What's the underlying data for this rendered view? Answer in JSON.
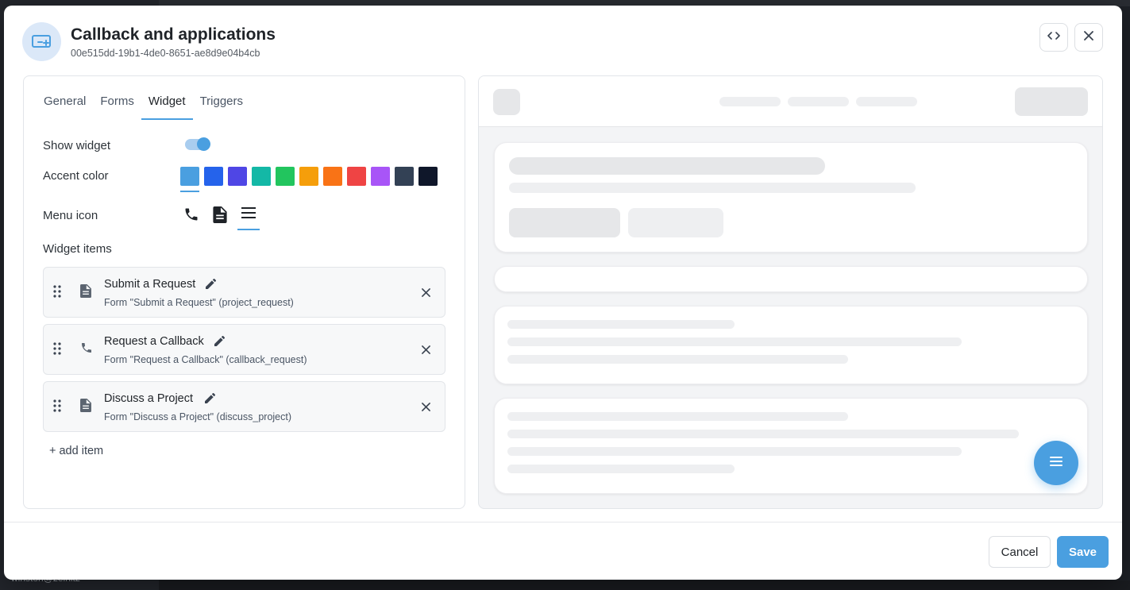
{
  "background": {
    "user_label": "winston@zeinitz"
  },
  "modal": {
    "title": "Callback and applications",
    "subtitle": "00e515dd-19b1-4de0-8651-ae8d9e04b4cb",
    "code_button_icon": "code-icon",
    "close_button_icon": "close-icon"
  },
  "tabs": [
    {
      "label": "General",
      "active": false
    },
    {
      "label": "Forms",
      "active": false
    },
    {
      "label": "Widget",
      "active": true
    },
    {
      "label": "Triggers",
      "active": false
    }
  ],
  "widget": {
    "show_widget_label": "Show widget",
    "show_widget_on": true,
    "accent_color_label": "Accent color",
    "accent_colors": [
      "#4a9fe0",
      "#2563eb",
      "#4f46e5",
      "#14b8a6",
      "#22c55e",
      "#f59e0b",
      "#f97316",
      "#ef4444",
      "#a855f7",
      "#334155",
      "#0f172a"
    ],
    "accent_selected": "#4a9fe0",
    "menu_icon_label": "Menu icon",
    "menu_icons": [
      "phone-icon",
      "document-icon",
      "menu-icon"
    ],
    "menu_icon_selected": "menu-icon",
    "items_label": "Widget items",
    "items": [
      {
        "title": "Submit a Request",
        "desc": "Form \"Submit a Request\" (project_request)",
        "icon": "document-icon"
      },
      {
        "title": "Request a Callback",
        "desc": "Form \"Request a Callback\" (callback_request)",
        "icon": "phone-icon"
      },
      {
        "title": "Discuss a Project",
        "desc": "Form \"Discuss a Project\" (discuss_project)",
        "icon": "document-icon"
      }
    ],
    "add_item_label": "+ add item"
  },
  "preview": {
    "fab_icon": "menu-icon",
    "accent": "#4a9fe0"
  },
  "footer": {
    "cancel_label": "Cancel",
    "save_label": "Save"
  }
}
